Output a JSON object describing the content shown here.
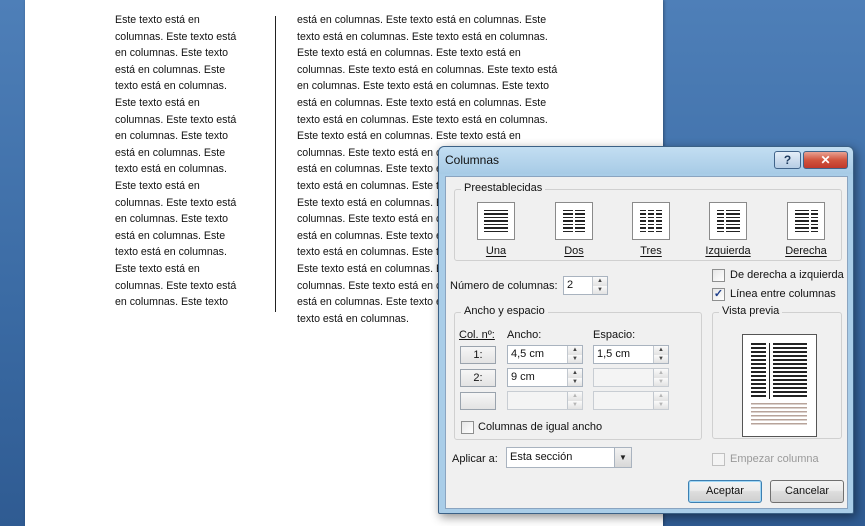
{
  "document": {
    "col1_text": "Este texto está en\ncolumnas. Este texto está\nen columnas. Este texto\nestá en columnas. Este\ntexto está en columnas.\nEste texto está en\ncolumnas. Este texto está\nen columnas. Este texto\nestá en columnas. Este\ntexto está en columnas.\nEste texto está en\ncolumnas. Este texto está\nen columnas. Este texto\nestá en columnas. Este\ntexto está en columnas.\nEste texto está en\ncolumnas. Este texto está\nen columnas. Este texto",
    "col2_text": "está en columnas. Este texto está en columnas. Este\ntexto está en columnas. Este texto está en columnas.\nEste texto está en columnas. Este texto está en\ncolumnas. Este texto está en columnas. Este texto está\nen columnas. Este texto está en columnas. Este texto\nestá en columnas. Este texto está en columnas. Este\ntexto está en columnas. Este texto está en columnas.\nEste texto está en columnas. Este texto está en\ncolumnas. Este texto está en columnas. Este texto\nestá en columnas. Este texto está en columnas. Este\ntexto está en columnas. Este texto está en columnas.\nEste texto está en columnas. Este texto está en\ncolumnas. Este texto está en columnas. Este texto\nestá en columnas. Este texto está en columnas. Este\ntexto está en columnas. Este texto está en columnas.\nEste texto está en columnas. Este texto está en\ncolumnas. Este texto está en columnas. Este texto\nestá en columnas. Este texto está en columnas. Este\ntexto está en columnas."
  },
  "dialog": {
    "title": "Columnas",
    "help_glyph": "?",
    "close_glyph": "✕",
    "presets_label": "Preestablecidas",
    "presets": [
      {
        "label": "Una"
      },
      {
        "label": "Dos"
      },
      {
        "label": "Tres"
      },
      {
        "label": "Izquierda"
      },
      {
        "label": "Derecha"
      }
    ],
    "num_columns_label": "Número de columnas:",
    "num_columns_value": "2",
    "rtl_label": "De derecha a izquierda",
    "rtl_checked": false,
    "line_between_label": "Línea entre columnas",
    "line_between_checked": true,
    "check_glyph": "✓",
    "width_spacing_label": "Ancho y espacio",
    "col_header": "Col. nº:",
    "width_header": "Ancho:",
    "spacing_header": "Espacio:",
    "rows": [
      {
        "num": "1:",
        "width": "4,5 cm",
        "spacing": "1,5 cm"
      },
      {
        "num": "2:",
        "width": "9 cm",
        "spacing": ""
      },
      {
        "num": "",
        "width": "",
        "spacing": ""
      }
    ],
    "equal_width_label": "Columnas de igual ancho",
    "equal_width_checked": false,
    "preview_label": "Vista previa",
    "apply_to_label": "Aplicar a:",
    "apply_to_value": "Esta sección",
    "new_column_label": "Empezar columna",
    "ok_label": "Aceptar",
    "cancel_label": "Cancelar"
  }
}
